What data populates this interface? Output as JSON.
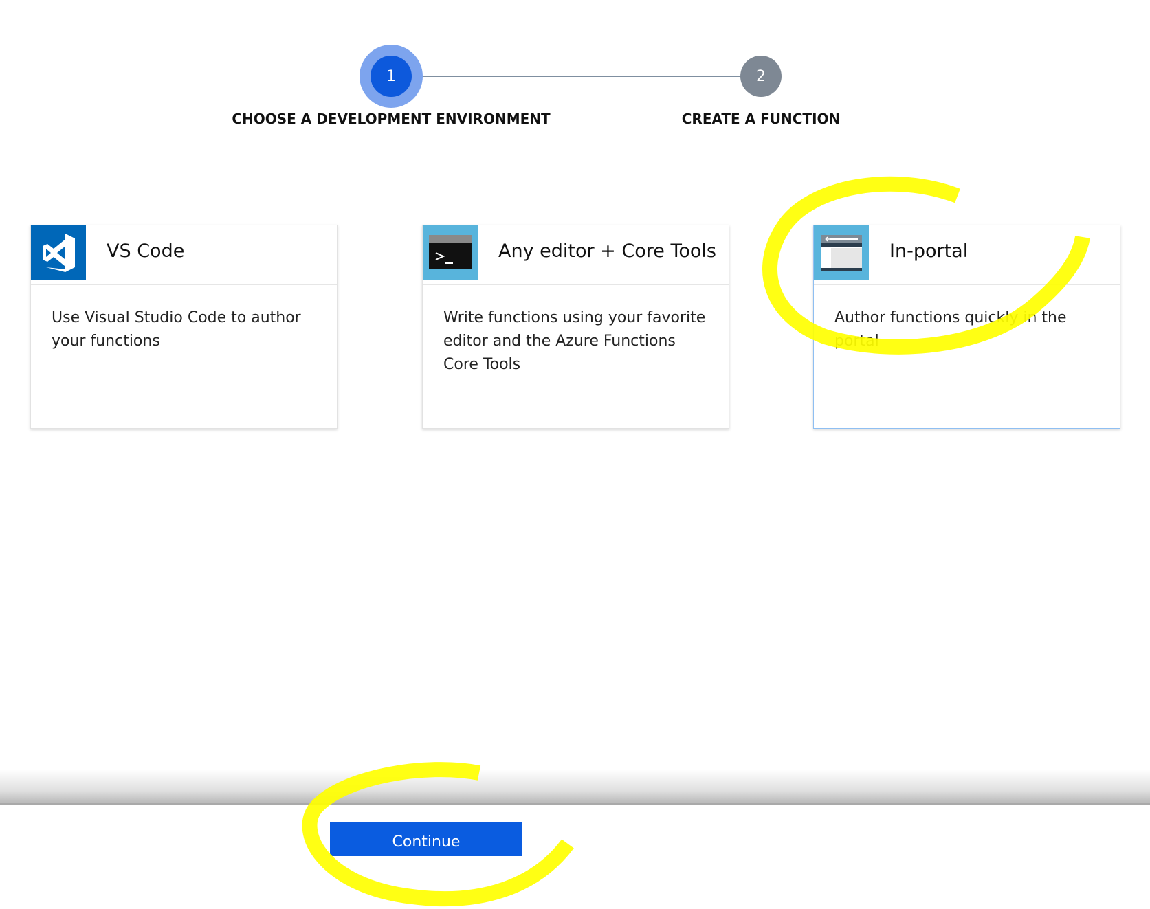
{
  "stepper": {
    "steps": [
      {
        "number": "1",
        "label": "CHOOSE A DEVELOPMENT ENVIRONMENT",
        "state": "active"
      },
      {
        "number": "2",
        "label": "CREATE A FUNCTION",
        "state": "inactive"
      }
    ]
  },
  "options": [
    {
      "title": "VS Code",
      "description": "Use Visual Studio Code to author your functions",
      "icon": "vscode-icon",
      "selected": false
    },
    {
      "title": "Any editor + Core Tools",
      "description": "Write functions using your favorite editor and the Azure Functions Core Tools",
      "icon": "terminal-icon",
      "selected": false
    },
    {
      "title": "In-portal",
      "description": "Author functions quickly in the portal",
      "icon": "browser-window-icon",
      "selected": true
    }
  ],
  "footer": {
    "continue_label": "Continue"
  },
  "colors": {
    "accent": "#0a5ce0",
    "active_step": "#0d59dc",
    "inactive_step": "#7e8894",
    "highlight_annotation": "#ffff00"
  }
}
